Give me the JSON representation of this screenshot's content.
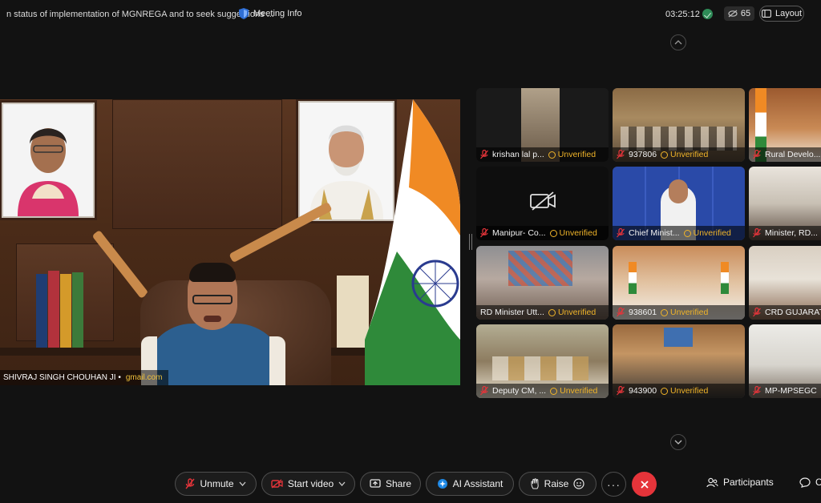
{
  "header": {
    "meeting_title": "n status of implementation of MGNREGA and to seek suggestions ...",
    "meeting_info_label": "Meeting Info",
    "elapsed_time": "03:25:12",
    "participant_count": "65",
    "layout_label": "Layout"
  },
  "main_speaker": {
    "name": "SHIVRAJ SINGH CHOUHAN JI •",
    "email_fragment": "gmail.com"
  },
  "tiles": [
    {
      "name": "krishan lal p...",
      "status": "Unverified"
    },
    {
      "name": "937806",
      "status": "Unverified"
    },
    {
      "name": "Rural Develo...",
      "status": ""
    },
    {
      "name": "Manipur- Co...",
      "status": "Unverified"
    },
    {
      "name": "Chief Minist...",
      "status": "Unverified"
    },
    {
      "name": "Minister, RD...",
      "status": ""
    },
    {
      "name": "RD Minister Utt...",
      "status": "Unverified"
    },
    {
      "name": "938601",
      "status": "Unverified"
    },
    {
      "name": "CRD GUJARAT",
      "status": ""
    },
    {
      "name": "Deputy CM, ...",
      "status": "Unverified"
    },
    {
      "name": "943900",
      "status": "Unverified"
    },
    {
      "name": "MP-MPSEGC",
      "status": ""
    }
  ],
  "toolbar": {
    "unmute_label": "Unmute",
    "start_video_label": "Start video",
    "share_label": "Share",
    "ai_assistant_label": "AI Assistant",
    "raise_label": "Raise",
    "more_label": "···",
    "participants_label": "Participants",
    "chat_label": "C"
  },
  "colors": {
    "background": "#121212",
    "unverified": "#f0b429",
    "end_call": "#e5343a",
    "mic_muted": "#e5343a"
  },
  "icons": [
    "shield-icon",
    "check-icon",
    "eye-slash-icon",
    "layout-icon",
    "chevron-up-icon",
    "chevron-down-icon",
    "mic-off-icon",
    "video-off-icon",
    "share-icon",
    "ai-icon",
    "hand-icon",
    "emoji-icon",
    "close-icon",
    "participants-icon",
    "chat-icon",
    "camera-off-icon",
    "clock-icon"
  ]
}
